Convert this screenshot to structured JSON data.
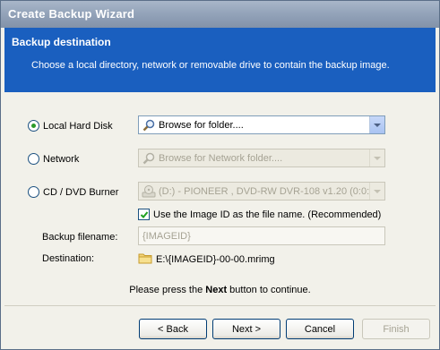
{
  "window": {
    "title": "Create Backup Wizard"
  },
  "header": {
    "title": "Backup destination",
    "description": "Choose a local directory, network  or removable drive to contain the backup image."
  },
  "options": {
    "local": {
      "label": "Local Hard Disk",
      "selected": true,
      "value": "Browse for folder....",
      "icon": "search-icon"
    },
    "network": {
      "label": "Network",
      "selected": false,
      "value": "Browse for Network folder....",
      "icon": "search-icon"
    },
    "cd": {
      "label": "CD / DVD Burner",
      "selected": false,
      "value": "(D:) - PIONEER , DVD-RW  DVR-108  v1.20 (0:0:",
      "icon": "disc-drive-icon"
    }
  },
  "use_image_id": {
    "label": "Use the Image ID as the file name.  (Recommended)",
    "checked": true
  },
  "backup_filename": {
    "label": "Backup filename:",
    "value": "{IMAGEID}"
  },
  "destination": {
    "label": "Destination:",
    "value": "E:\\{IMAGEID}-00-00.mrimg",
    "icon": "folder-icon"
  },
  "hint": {
    "prefix": "Please press the ",
    "bold": "Next",
    "suffix": " button to continue."
  },
  "buttons": {
    "back": "< Back",
    "next": "Next >",
    "cancel": "Cancel",
    "finish": "Finish"
  },
  "colors": {
    "header_bg": "#1a5fbf",
    "radio_dot": "#2b9a2b"
  }
}
